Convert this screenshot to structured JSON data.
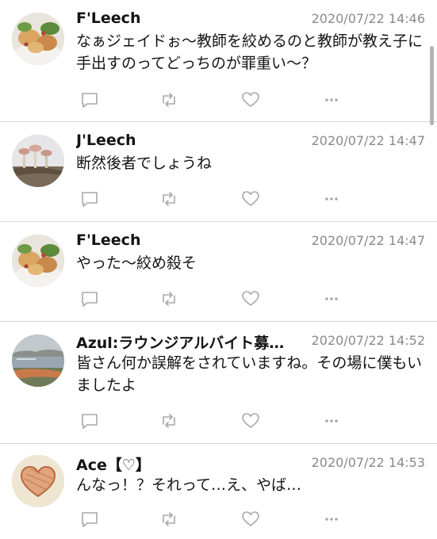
{
  "tweets": [
    {
      "name": "F'Leech",
      "time": "2020/07/22 14:46",
      "text": "なぁジェイドぉ〜教師を絞めるのと教師が教え子に手出すのってどっちのが罪重い〜？",
      "avatar": "food-avatar-icon"
    },
    {
      "name": "J'Leech",
      "time": "2020/07/22 14:47",
      "text": "断然後者でしょうね",
      "avatar": "mushroom-avatar-icon"
    },
    {
      "name": "F'Leech",
      "time": "2020/07/22 14:47",
      "text": "やった〜絞め殺そ",
      "avatar": "food-avatar-icon"
    },
    {
      "name": "Azul:ラウンジアルバイト募…",
      "time": "2020/07/22 14:52",
      "text": "皆さん何か誤解をされていますね。その場に僕もいましたよ",
      "avatar": "landscape-avatar-icon"
    },
    {
      "name": "Ace【♡】",
      "time": "2020/07/22 14:53",
      "text": "んなっ！？それって…え、やば…",
      "avatar": "heart-avatar-icon"
    }
  ],
  "icons": {
    "reply": "reply-icon",
    "retweet": "retweet-icon",
    "like": "like-icon",
    "more": "more-icon"
  },
  "colors": {
    "text": "#141414",
    "meta": "#8a8a8a",
    "icon": "#a8a8a8",
    "divider": "#d8d8d8"
  }
}
